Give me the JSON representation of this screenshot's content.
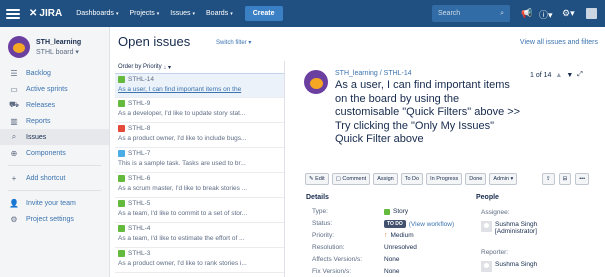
{
  "topbar": {
    "logo": "JIRA",
    "nav": [
      {
        "label": "Dashboards"
      },
      {
        "label": "Projects"
      },
      {
        "label": "Issues"
      },
      {
        "label": "Boards"
      }
    ],
    "create_label": "Create",
    "search_placeholder": "Search"
  },
  "sidebar": {
    "project_name": "STH_learning",
    "board_name": "STHL board",
    "items": [
      {
        "label": "Backlog",
        "icon": "backlog-icon"
      },
      {
        "label": "Active sprints",
        "icon": "sprint-icon"
      },
      {
        "label": "Releases",
        "icon": "releases-icon"
      },
      {
        "label": "Reports",
        "icon": "reports-icon"
      },
      {
        "label": "Issues",
        "icon": "issues-icon"
      },
      {
        "label": "Components",
        "icon": "components-icon"
      }
    ],
    "add_shortcut": "Add shortcut",
    "invite_team": "Invite your team",
    "project_settings": "Project settings"
  },
  "main": {
    "title": "Open issues",
    "switch_filter": "Switch filter",
    "view_all": "View all issues and filters",
    "order_by": "Order by Priority"
  },
  "issues": [
    {
      "key": "STHL-14",
      "summary": "As a user, I can find important items on the",
      "type_color": "#63ba3c"
    },
    {
      "key": "STHL-9",
      "summary": "As a developer, I'd like to update story stat...",
      "type_color": "#63ba3c"
    },
    {
      "key": "STHL-8",
      "summary": "As a product owner, I'd like to include bugs...",
      "type_color": "#e5493a"
    },
    {
      "key": "STHL-7",
      "summary": "This is a sample task. Tasks are used to br...",
      "type_color": "#4bade8"
    },
    {
      "key": "STHL-6",
      "summary": "As a scrum master, I'd like to break stories ...",
      "type_color": "#63ba3c"
    },
    {
      "key": "STHL-5",
      "summary": "As a team, I'd like to commit to a set of stor...",
      "type_color": "#63ba3c"
    },
    {
      "key": "STHL-4",
      "summary": "As a team, I'd like to estimate the effort of ...",
      "type_color": "#63ba3c"
    },
    {
      "key": "STHL-3",
      "summary": "As a product owner, I'd like to rank stories i...",
      "type_color": "#63ba3c"
    }
  ],
  "detail": {
    "project_crumb": "STH_learning",
    "key_crumb": "STHL-14",
    "title": "As a user, I can find important items on the board by using the customisable \"Quick Filters\" above >> Try clicking the \"Only My Issues\" Quick Filter above",
    "pager": "1 of 14",
    "actions": [
      "Edit",
      "Comment",
      "Assign",
      "To Do",
      "In Progress",
      "Done",
      "Admin"
    ],
    "details_heading": "Details",
    "people_heading": "People",
    "fields": [
      {
        "label": "Type:",
        "value": "Story"
      },
      {
        "label": "Status:",
        "value": "TO DO",
        "extra": "(View workflow)"
      },
      {
        "label": "Priority:",
        "value": "Medium"
      },
      {
        "label": "Resolution:",
        "value": "Unresolved"
      },
      {
        "label": "Affects Version/s:",
        "value": "None"
      },
      {
        "label": "Fix Version/s:",
        "value": "None"
      }
    ],
    "assignee_label": "Assignee:",
    "assignee": "Sushma Singh",
    "assignee_role": "[Administrator]",
    "reporter_label": "Reporter:",
    "reporter": "Sushma Singh"
  }
}
